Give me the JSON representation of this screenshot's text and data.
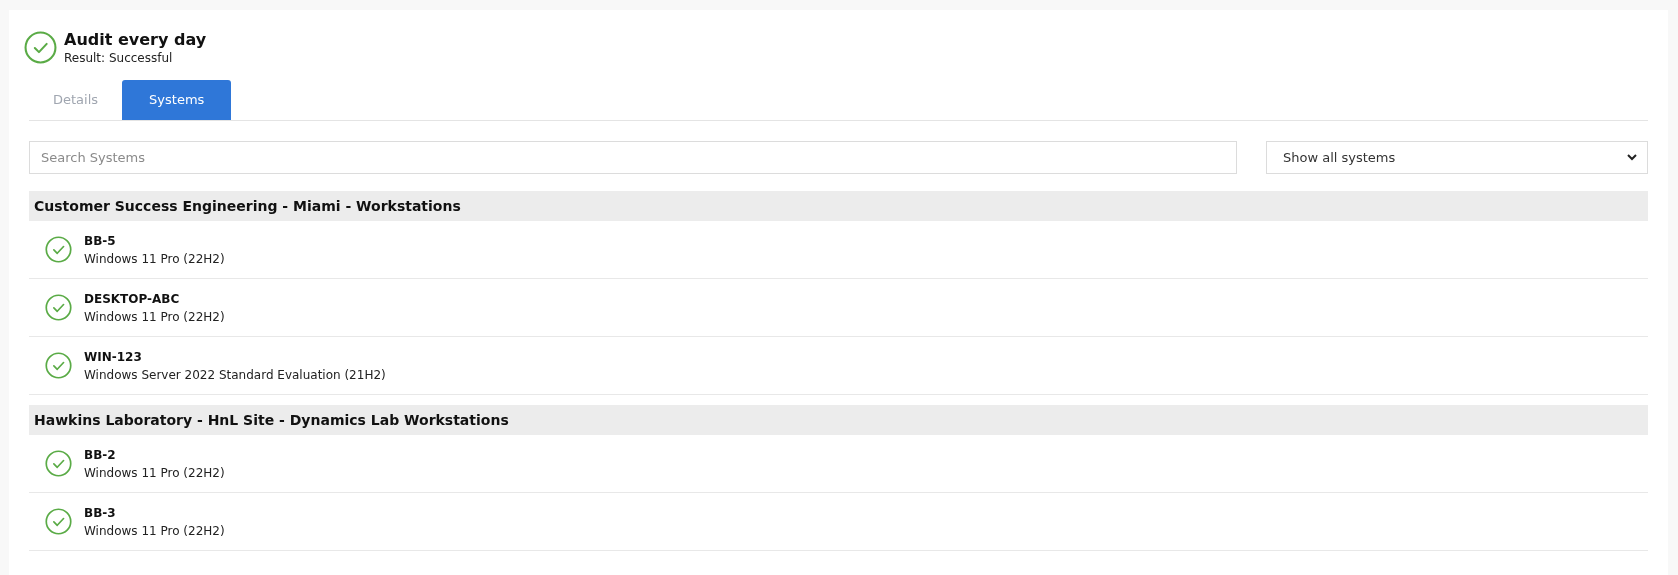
{
  "header": {
    "title": "Audit every day",
    "result": "Result: Successful",
    "kind": "success"
  },
  "tabs": [
    {
      "label": "Details",
      "selected": false
    },
    {
      "label": "Systems",
      "selected": true
    }
  ],
  "search": {
    "placeholder": "Search Systems"
  },
  "filter": {
    "value": "Show all systems"
  },
  "groups": [
    {
      "name": "Customer Success Engineering - Miami - Workstations",
      "systems": [
        {
          "name": "BB-5",
          "os": "Windows 11 Pro (22H2)",
          "kind": "success"
        },
        {
          "name": "DESKTOP-ABC",
          "os": "Windows 11 Pro (22H2)",
          "kind": "success"
        },
        {
          "name": "WIN-123",
          "os": "Windows Server 2022 Standard Evaluation (21H2)",
          "kind": "success"
        }
      ]
    },
    {
      "name": "Hawkins Laboratory - HnL Site - Dynamics Lab Workstations",
      "systems": [
        {
          "name": "BB-2",
          "os": "Windows 11 Pro (22H2)",
          "kind": "success"
        },
        {
          "name": "BB-3",
          "os": "Windows 11 Pro (22H2)",
          "kind": "success"
        }
      ]
    }
  ]
}
